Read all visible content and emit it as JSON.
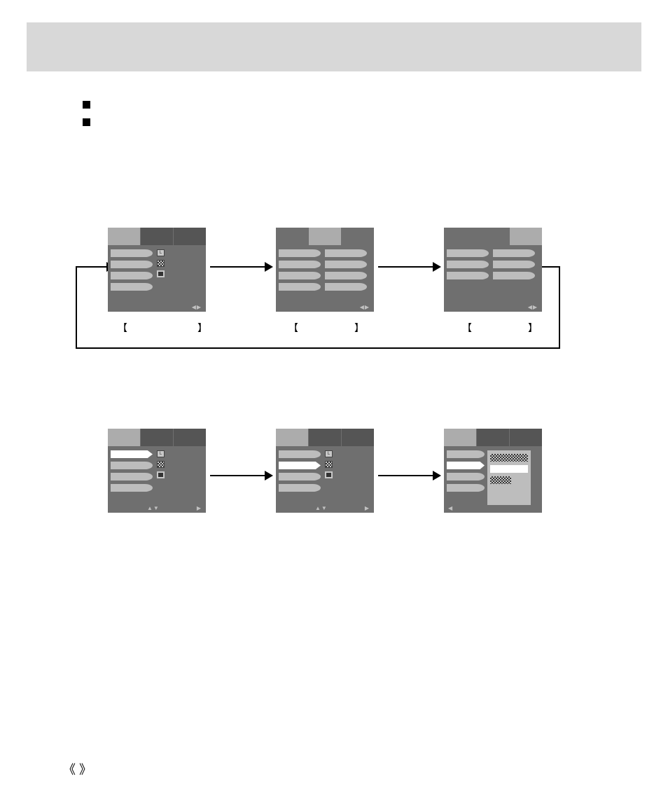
{
  "header": {
    "title": ""
  },
  "bullets": [
    "",
    ""
  ],
  "row1": {
    "screens": [
      {
        "label": "",
        "footer": "◀▶"
      },
      {
        "label": "",
        "footer": "◀▶"
      },
      {
        "label": "",
        "footer": "◀▶"
      }
    ]
  },
  "row2": {
    "screens": [
      {
        "footer_center": "▲▼",
        "footer_right": "▶"
      },
      {
        "footer_center": "▲▼",
        "footer_right": "▶"
      },
      {
        "footer_left": "◀"
      }
    ]
  },
  "icons": {
    "L": "L"
  },
  "page_marker": "《  》"
}
